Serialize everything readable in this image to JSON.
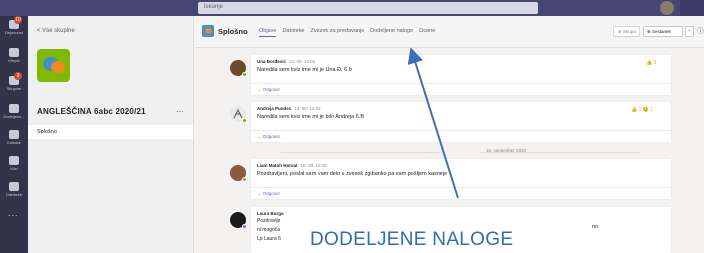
{
  "topbar": {
    "search_placeholder": "Iskanje",
    "notification_badge": "10"
  },
  "rail": {
    "items": [
      {
        "icon": "activity-icon",
        "label": "Dejavnost",
        "badge": "10"
      },
      {
        "icon": "chat-icon",
        "label": "Klepet",
        "badge": ""
      },
      {
        "icon": "teams-icon",
        "label": "Skupine",
        "badge": "3"
      },
      {
        "icon": "assignments-icon",
        "label": "Dodeljene...",
        "badge": ""
      },
      {
        "icon": "calendar-icon",
        "label": "Koledar",
        "badge": ""
      },
      {
        "icon": "calls-icon",
        "label": "Klici",
        "badge": ""
      },
      {
        "icon": "files-icon",
        "label": "Datoteke",
        "badge": ""
      }
    ],
    "more": "..."
  },
  "team_panel": {
    "back": "< Vse skupine",
    "team_name": "ANGLEŠČINA 6abc 2020/21",
    "more": "...",
    "channel": "Splošno"
  },
  "channel_header": {
    "channel_name": "Splošno",
    "tabs": [
      {
        "label": "Objave",
        "active": true
      },
      {
        "label": "Datoteke",
        "active": false
      },
      {
        "label": "Zvezek za predavanje",
        "active": false
      },
      {
        "label": "Dodeljene naloge",
        "active": false
      },
      {
        "label": "Ocene",
        "active": false
      }
    ],
    "meet_small": "⊕ Skupa",
    "meet_button": "⊕ Sestanek",
    "caret": "⌄",
    "info": "ⓘ"
  },
  "posts": [
    {
      "author": "Una Đorđević",
      "time": "14. 09. 14:01",
      "message": "Naredila sem kviz ime mi je Una Đ. 6.b",
      "reply": "← Odgovor",
      "reactions": "👍 3"
    },
    {
      "author": "Andreja Pundec",
      "time": "14. 09. 14:43",
      "message": "Naredila sem kviz ime mi je bilo Andreja 6.B",
      "reply": "← Odgovor",
      "reactions": "👍 1  😟 1"
    },
    {
      "author": "Liam Matoh Horvat",
      "time": "15. 09. 10:26",
      "message": "Pozdravljeni, poslal sem vam delo v zvezek zgibanko pa vam pošljem kasneje",
      "reply": "← Odgovor",
      "reactions": ""
    },
    {
      "author": "Laura Burga",
      "lines": [
        "Pozdravlje",
        "ni mogoča",
        "Lp Laura 6"
      ],
      "trunc": "no"
    }
  ],
  "date_separator": "15. september 2020",
  "annotation": {
    "label": "DODELJENE NALOGE",
    "color": "#2f6db5"
  }
}
